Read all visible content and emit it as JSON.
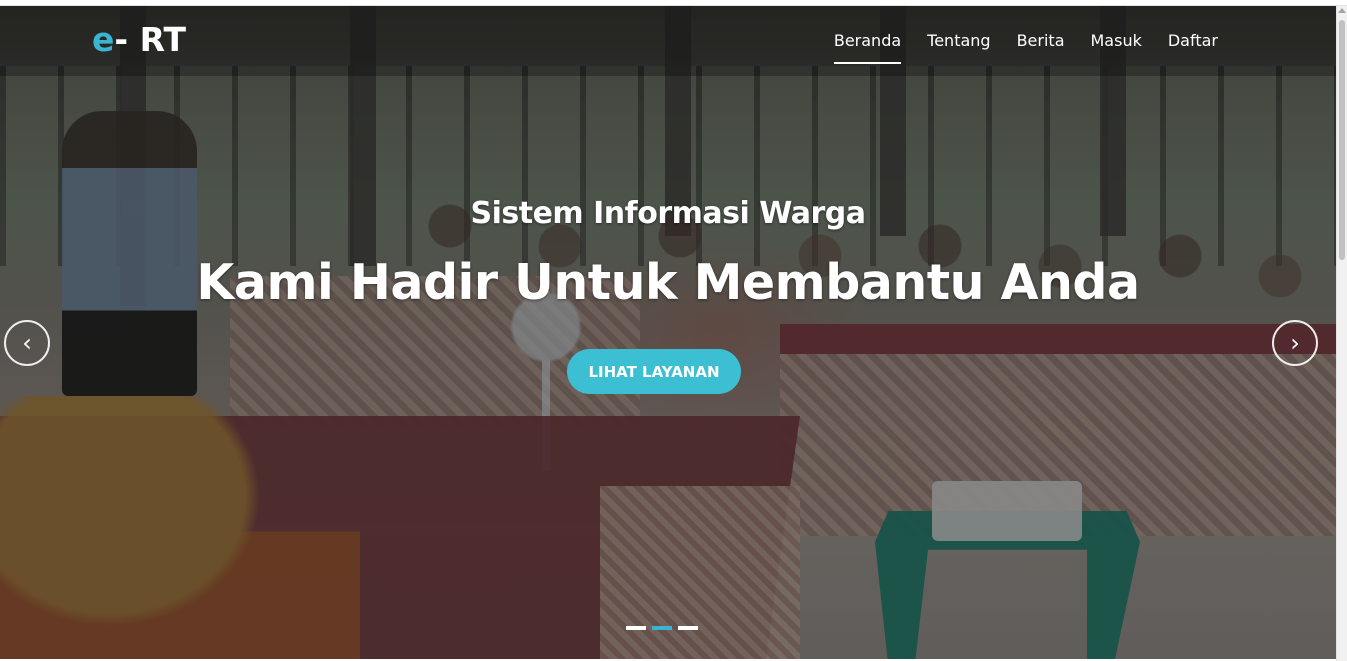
{
  "brand": {
    "prefix": "e",
    "suffix": "- RT",
    "accent_color": "#3bb4d4"
  },
  "nav": {
    "items": [
      {
        "label": "Beranda",
        "active": true
      },
      {
        "label": "Tentang",
        "active": false
      },
      {
        "label": "Berita",
        "active": false
      },
      {
        "label": "Masuk",
        "active": false
      },
      {
        "label": "Daftar",
        "active": false
      }
    ]
  },
  "hero": {
    "subtitle": "Sistem Informasi Warga",
    "title": "Kami Hadir Untuk Membantu Anda",
    "cta_label": "LIHAT LAYANAN",
    "cta_color": "#3cbfd2",
    "prev_icon": "chevron-left-icon",
    "next_icon": "chevron-right-icon",
    "prev_glyph": "‹",
    "next_glyph": "›",
    "slides": {
      "count": 3,
      "active_index": 1
    }
  }
}
